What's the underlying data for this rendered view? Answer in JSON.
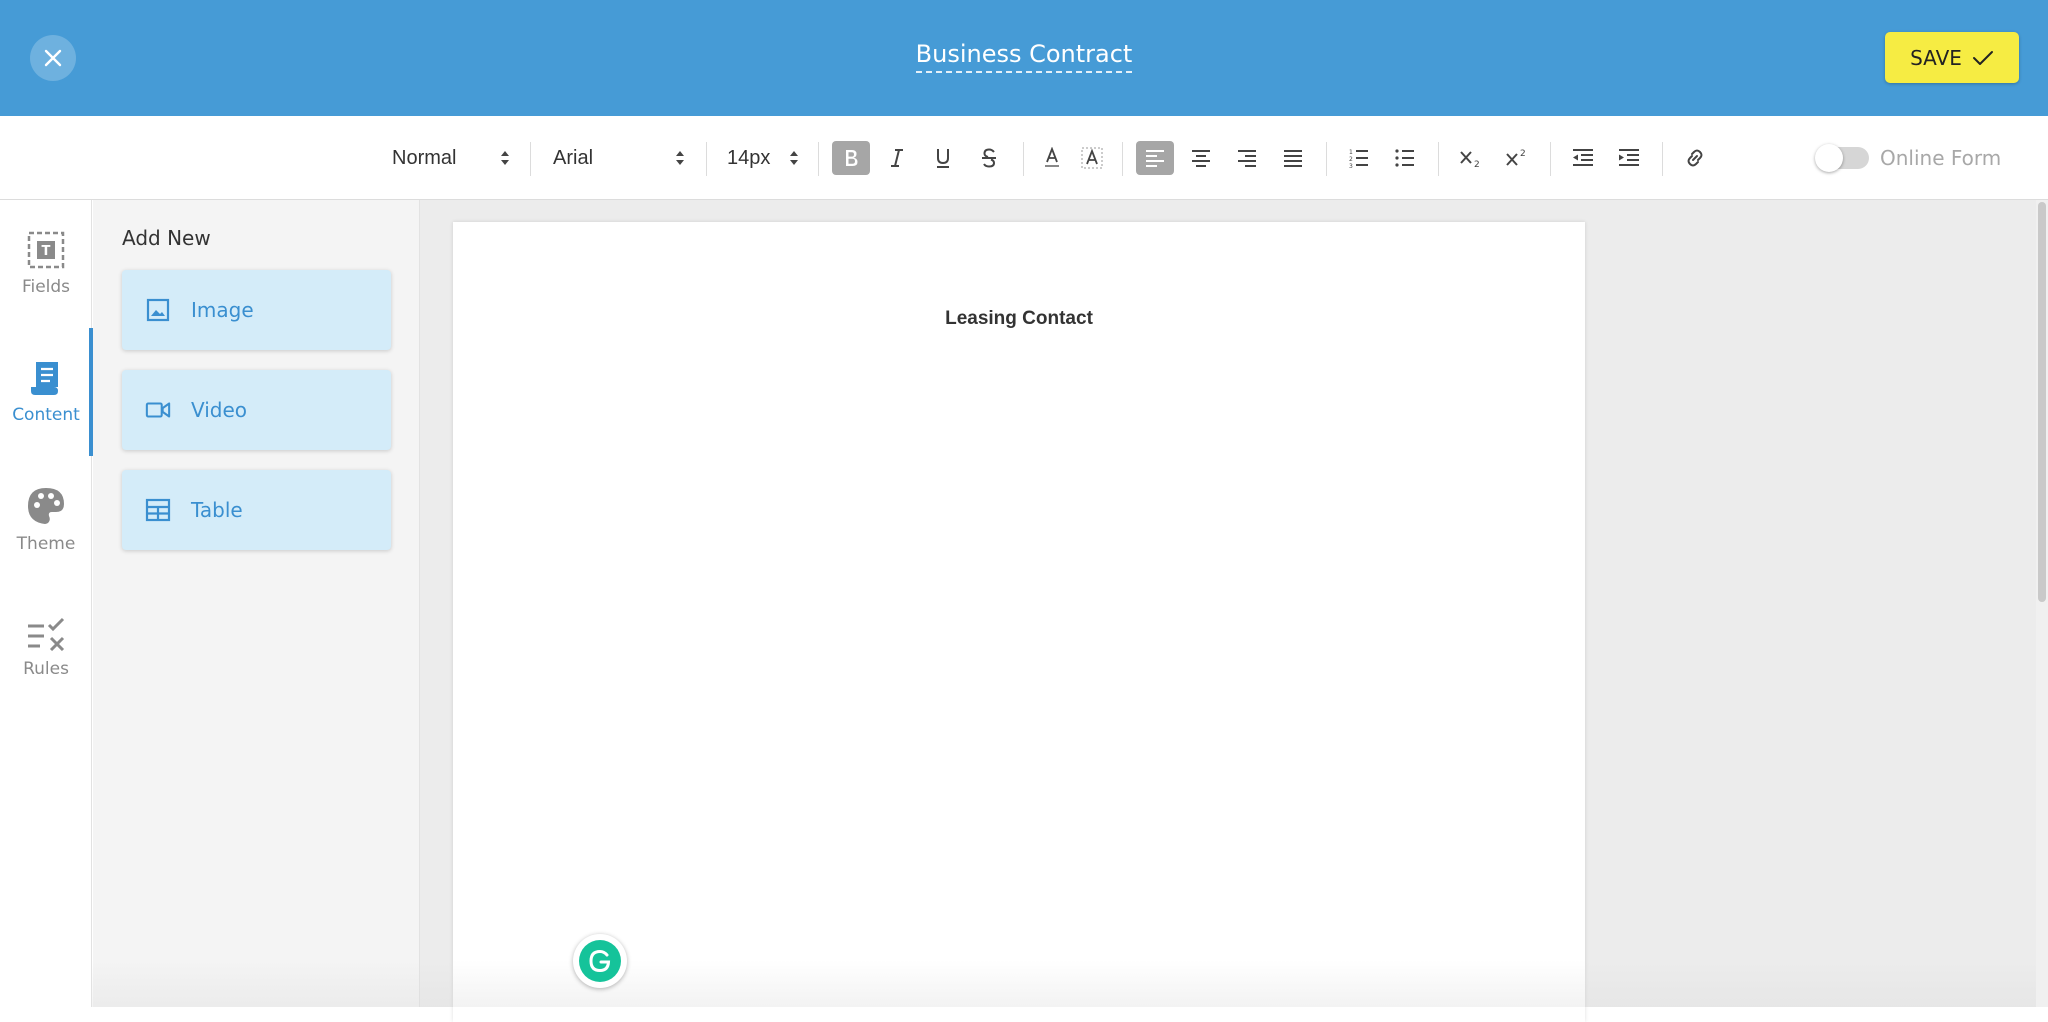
{
  "header": {
    "document_title": "Business Contract",
    "save_label": "SAVE",
    "colors": {
      "header_bg": "#469bd6",
      "save_bg": "#f6ec43"
    }
  },
  "toolbar": {
    "paragraph_style": "Normal",
    "font_family": "Arial",
    "font_size": "14px",
    "buttons": [
      "bold",
      "italic",
      "underline",
      "strikethrough",
      "font-color",
      "highlight-color",
      "align-left",
      "align-center",
      "align-right",
      "align-justify",
      "ordered-list",
      "bullet-list",
      "subscript",
      "superscript",
      "outdent",
      "indent",
      "link"
    ],
    "active_buttons": [
      "bold",
      "align-left"
    ],
    "online_form_label": "Online Form",
    "online_form_enabled": false
  },
  "sidebar": {
    "items": [
      {
        "label": "Fields",
        "icon": "text-field-icon"
      },
      {
        "label": "Content",
        "icon": "document-scroll-icon",
        "active": true
      },
      {
        "label": "Theme",
        "icon": "palette-icon"
      },
      {
        "label": "Rules",
        "icon": "rules-checklist-icon"
      }
    ]
  },
  "panel": {
    "title": "Add New",
    "items": [
      {
        "label": "Image",
        "icon": "image-icon"
      },
      {
        "label": "Video",
        "icon": "video-camera-icon"
      },
      {
        "label": "Table",
        "icon": "table-icon"
      }
    ]
  },
  "document": {
    "heading": "Leasing Contact"
  }
}
